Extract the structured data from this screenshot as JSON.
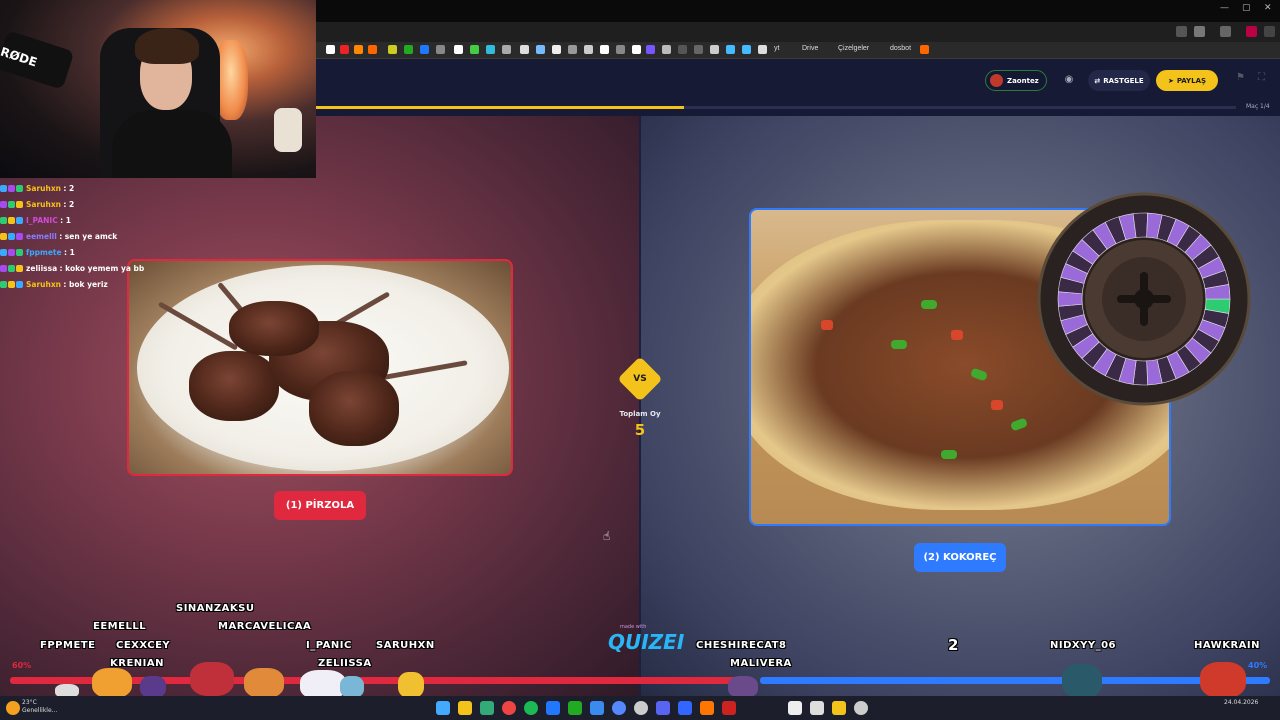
{
  "browser": {
    "bookmarks": [
      "yt",
      "Drive",
      "Çizelgeler",
      "dosbot"
    ]
  },
  "header": {
    "user": "Zaontez",
    "random_label": "RASTGELE",
    "share_label": "PAYLAŞ",
    "step": "Maç 1/4",
    "progress": 0.4
  },
  "game": {
    "left_label": "(1) PİRZOLA",
    "right_label": "(2) KOKOREÇ",
    "vs": "VS",
    "total_label": "Toplam Oy",
    "total_value": "5",
    "left_percent": "60%",
    "right_percent": "40%",
    "right_votes": "2",
    "made_with": "made with",
    "brand": "QUIZEI",
    "colors": {
      "left": "#e0283e",
      "right": "#2f7bff",
      "accent": "#f4c31b"
    }
  },
  "webcam": {
    "mic_brand": "RØDE"
  },
  "chat": [
    {
      "user": "Saruhxn",
      "color": "#f4c31b",
      "msg": ": 2"
    },
    {
      "user": "Saruhxn",
      "color": "#f4c31b",
      "msg": ": 2"
    },
    {
      "user": "I_PANIC",
      "color": "#d14bd8",
      "msg": ": 1"
    },
    {
      "user": "eemelll",
      "color": "#8a7bff",
      "msg": ": sen ye amck"
    },
    {
      "user": "fppmete",
      "color": "#3aa9ff",
      "msg": ": 1"
    },
    {
      "user": "zeliissa",
      "color": "#ffffff",
      "msg": ": koko yemem ya bb"
    },
    {
      "user": "Saruhxn",
      "color": "#f4c31b",
      "msg": ": bok yeriz"
    }
  ],
  "viewers_left": [
    "SINANZAKSU",
    "EEMELLL",
    "MARCAVELICAA",
    "FPPMETE",
    "CEXXCEY",
    "I_PANIC",
    "SARUHXN",
    "KRENIAN",
    "ZELIISSA"
  ],
  "viewers_right": [
    "CHESHIRECAT8",
    "MALIVERA",
    "NIDXYY_06",
    "HAWKRAIN"
  ],
  "taskbar": {
    "weather_temp": "23°C",
    "weather_desc": "Genellikle...",
    "date": "24.04.2026"
  }
}
